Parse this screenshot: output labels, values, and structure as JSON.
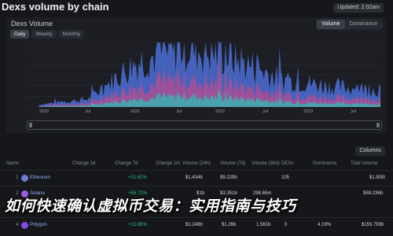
{
  "header": {
    "title": "Dexs volume by chain",
    "updated_label": "Updated: 2:02am"
  },
  "chart_panel": {
    "title": "Dexs Volume",
    "range_buttons": [
      "Daily",
      "Weekly",
      "Monthly"
    ],
    "active_range": "Daily",
    "metric_buttons": [
      "Volume",
      "Dominance"
    ],
    "active_metric": "Volume",
    "y_ticks": [
      "—",
      "—",
      "—",
      "—",
      "—",
      "—",
      "—",
      "—"
    ],
    "x_ticks": [
      "2020",
      "Jul",
      "2021",
      "Jul",
      "2022",
      "Jul",
      "2023",
      "Jul"
    ],
    "colors": {
      "series_a": "#4b6fd6",
      "series_b": "#c24b8c",
      "series_c": "#35b6b0"
    }
  },
  "chart_data": {
    "type": "area",
    "x": [
      "2020",
      "Jul",
      "2021",
      "Jul",
      "2022",
      "Jul",
      "2023",
      "Jul"
    ],
    "series": [
      {
        "values": [
          0.2,
          0.6,
          3.5,
          4.6,
          3.8,
          2.1,
          1.6,
          1.3
        ]
      }
    ],
    "grid": true,
    "legend": "none"
  },
  "columns_button": "Columns",
  "table": {
    "headers": [
      "Name",
      "Change 1d",
      "Change 7d",
      "Change 1m",
      "Volume (24h)",
      "Volume (7d)",
      "Volume (30d)",
      "DEXs",
      "Dominance",
      "Total Volume"
    ],
    "rows": [
      {
        "rank": "1",
        "name": "Ethereum",
        "icon_color": "#6c7bd8",
        "change_1d": "",
        "change_7d": "+21.62%",
        "change_1m": "",
        "vol_24h": "$1.434b",
        "vol_7d": "$9.229b",
        "vol_30d": "",
        "dexs": "105",
        "dominance": "",
        "total": "$1.905t"
      },
      {
        "rank": "2",
        "name": "Solana",
        "icon_color": "#9c5ce0",
        "change_1d": "",
        "change_7d": "+65.72%",
        "change_1m": "",
        "vol_24h": "$1b",
        "vol_7d": "$3.351b",
        "vol_30d": "298.65m",
        "dexs": "",
        "dominance": "",
        "total": "$59.236b"
      },
      {
        "rank": "4",
        "name": "Polygon",
        "icon_color": "#8247e5",
        "change_1d": "",
        "change_7d": "+12.88%",
        "change_1m": "",
        "vol_24h": "$1.248b",
        "vol_7d": "$1.26b",
        "vol_30d": "1.561b",
        "dexs": "0",
        "dominance": "4.19%",
        "total": "$155.793b"
      }
    ]
  },
  "overlay_text": "如何快速确认虚拟币交易：实用指南与技巧"
}
